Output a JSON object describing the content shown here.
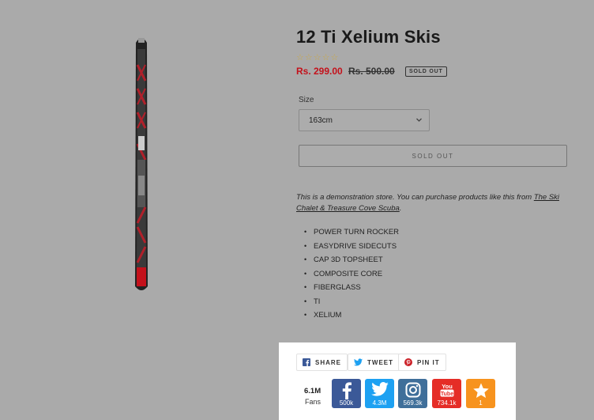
{
  "product": {
    "title": "12 Ti Xelium Skis",
    "rating_stars": "☆☆☆☆☆",
    "price": "Rs. 299.00",
    "compare_price": "Rs. 500.00",
    "badge": "SOLD OUT",
    "size_label": "Size",
    "size_value": "163cm",
    "button_label": "SOLD OUT",
    "description_prefix": "This is a demonstration store. You can purchase products like this from ",
    "description_link": "The Ski Chalet & Treasure Cove Scuba",
    "description_suffix": ".",
    "features": [
      "POWER TURN ROCKER",
      "EASYDRIVE SIDECUTS",
      "CAP 3D TOPSHEET",
      "COMPOSITE CORE",
      "FIBERGLASS",
      "TI",
      "XELIUM"
    ]
  },
  "share": {
    "share_label": "SHARE",
    "tweet_label": "TWEET",
    "pin_label": "PIN IT",
    "fans_count": "6.1M",
    "fans_label": "Fans",
    "networks": [
      {
        "icon": "facebook-icon",
        "count": "500k",
        "color": "#3b5998"
      },
      {
        "icon": "twitter-icon",
        "count": "4.3M",
        "color": "#1da1f2"
      },
      {
        "icon": "instagram-icon",
        "count": "569.3k",
        "color": "#3f6f9a"
      },
      {
        "icon": "youtube-icon",
        "count": "734.1k",
        "color": "#e52d27"
      },
      {
        "icon": "star-icon",
        "count": "1",
        "color": "#f7931e"
      }
    ]
  }
}
